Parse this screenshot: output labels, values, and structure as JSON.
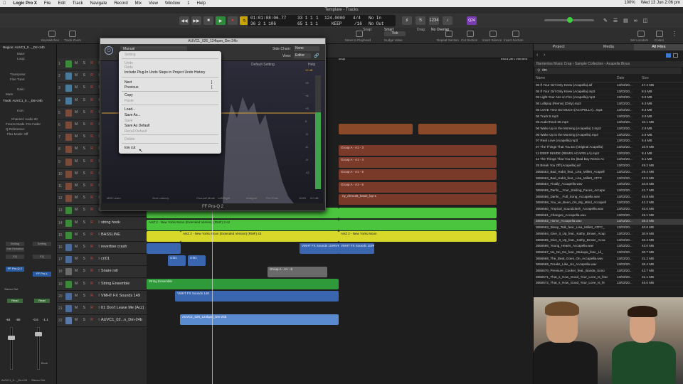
{
  "menubar": {
    "app": "Logic Pro X",
    "items": [
      "File",
      "Edit",
      "Track",
      "Navigate",
      "Record",
      "Mix",
      "View",
      "Window",
      "1",
      "Help"
    ],
    "clock": "Wed 13 Jun 2:06 pm",
    "battery": "100%"
  },
  "window_title": "Template - Tracks",
  "lcd": {
    "time": "01:01:08:06.77",
    "bars1": "33 1 1",
    "beats1": "1",
    "tempo": "124.0000",
    "sig": "4/4",
    "in": "No In",
    "time2": "36 2 1 106",
    "bars2": "65 1 1 1",
    "keep": "KEEP",
    "div": "/16",
    "out": "No Out"
  },
  "cpu": "Q24",
  "toolbar": {
    "labels": [
      "Keyswitches",
      "Track Zoom",
      "Move to Playhead",
      "Nudge Value",
      "Repeat Section",
      "Cut Section",
      "Insert Silence",
      "Insert Section",
      "Set Locators",
      "Colors",
      "Notes",
      "Lists",
      "Loops",
      "Browser"
    ],
    "snap_label": "Snap:",
    "snap_value": "Smart",
    "drag_label": "Drag:",
    "drag_value": "No Overlap",
    "tick": "Tick"
  },
  "inspector": {
    "region_label": "Region: AUVC1_0..._Dm-24b",
    "rows": [
      "Mute:",
      "Loop:",
      "Transpose:",
      "Fine Tune:",
      "Gain:",
      "More"
    ],
    "track_label": "Track: AUVC1_0..._Dm-24b",
    "track_rows": [
      "Icon:",
      "Channel: Audio 30",
      "Freeze Mode: Pre Fader",
      "Q-Reference:",
      "Flex Mode: Off"
    ],
    "strip_labels": [
      "Setting",
      "Gain Reduction",
      "EQ",
      "FF Pro-Q 2",
      "FF Pro-L",
      "Stereo Out",
      "Read",
      "Bnce",
      "Stereo Out"
    ],
    "meters": [
      "-64",
      "-88",
      "-0.6",
      "-1.1"
    ],
    "names": [
      "AUVC1_0..._Dm-24b",
      "Stereo Out"
    ]
  },
  "tracks": [
    {
      "n": "1",
      "name": ""
    },
    {
      "n": "2",
      "name": ""
    },
    {
      "n": "3",
      "name": ""
    },
    {
      "n": "4",
      "name": ""
    },
    {
      "n": "5",
      "name": ""
    },
    {
      "n": "6",
      "name": ""
    },
    {
      "n": "7",
      "name": ""
    },
    {
      "n": "8",
      "name": ""
    },
    {
      "n": "9",
      "name": ""
    },
    {
      "n": "10",
      "name": ""
    },
    {
      "n": "11",
      "name": ""
    },
    {
      "n": "12",
      "name": ""
    },
    {
      "n": "13",
      "name": "guitar loop"
    },
    {
      "n": "14",
      "name": "string hook"
    },
    {
      "n": "15",
      "name": "BASSLINE"
    },
    {
      "n": "16",
      "name": "reverbse crash"
    },
    {
      "n": "17",
      "name": "cri01"
    },
    {
      "n": "18",
      "name": "Snare roll"
    },
    {
      "n": "19",
      "name": "String Ensemble"
    },
    {
      "n": "20",
      "name": "VMHT FX Sounds 149"
    },
    {
      "n": "21",
      "name": "01 Don't Leave Me (Acc)"
    },
    {
      "n": "22",
      "name": "AUVC1_02...n_Dm-24b"
    }
  ],
  "regions": [
    "Group A - A1 - 3",
    "Group A - A1 - 4",
    "Group A - A1 - 5",
    "Group A - A1 - 6",
    "AHZ 2 - New Yorks Moon (Extended Version) (RMF) 3 A2",
    "AHZ 2 - New Yorks Moon (Extended Version) (RMF) 43",
    "AHZ 2 - New Yorks Moon",
    "VMHT FX Sounds 119RVE",
    "VMHT FX Sounds 119RVE",
    "cri01",
    "cri01",
    "Group A - A1 - 6",
    "String Ensemble",
    "VMHT FX Sounds 148",
    "AUVC1_026_124bpm_Dm-24b",
    "drop",
    "extra perc element",
    "ny_drm135_kasie_lop-1"
  ],
  "plugin": {
    "title": "AUVC1_026_124bpm_Dm-24b",
    "side_chain_label": "Side Chain:",
    "side_chain_value": "None",
    "view_label": "View:",
    "view_value": "Editor",
    "preset": "Manual",
    "default_setting": "Default Setting",
    "help": "Help",
    "footer": "FF Pro-Q 2",
    "bottom": [
      "MIDI Learn",
      "Zero Latency",
      "Channel Mode",
      "Left/Right",
      "Analyzer",
      "Pre+Post",
      "100%",
      "0.0 dB"
    ],
    "db_labels": [
      "12 dB",
      "+9",
      "+6",
      "+3",
      "0",
      "-3",
      "-6",
      "-9",
      "-12"
    ]
  },
  "context_menu": {
    "items": [
      {
        "label": "Setting",
        "disabled": true
      },
      {
        "label": "Undo",
        "disabled": true
      },
      {
        "label": "Redo",
        "disabled": true
      },
      {
        "label": "Include Plug-In Undo Steps in Project Undo History",
        "disabled": false
      },
      {
        "label": "Next",
        "disabled": false,
        "shortcut": "]"
      },
      {
        "label": "Previous",
        "disabled": false,
        "shortcut": "["
      },
      {
        "label": "Copy",
        "disabled": false
      },
      {
        "label": "Paste",
        "disabled": true
      },
      {
        "label": "Load...",
        "disabled": false
      },
      {
        "label": "Save As...",
        "disabled": false
      },
      {
        "label": "Save",
        "disabled": true
      },
      {
        "label": "Save As Default",
        "disabled": false
      },
      {
        "label": "Recall Default",
        "disabled": true
      },
      {
        "label": "Delete",
        "disabled": true
      },
      {
        "label": "low cut",
        "disabled": false
      }
    ]
  },
  "browser": {
    "tabs": [
      "Project",
      "Media",
      "All Files"
    ],
    "path": [
      "Barrientos Music Crap",
      "Sample Collection",
      "Acapella Biyus"
    ],
    "search": "dm",
    "cols": [
      "Name",
      "Date",
      "Size"
    ],
    "files": [
      [
        "05 If Your Girl Only Knew (Acapella).aif",
        "13/03/20...",
        "47.4 MB"
      ],
      [
        "05 If Your Girl Only Knew (Acapella).mp3",
        "13/03/20...",
        "8.5 MB"
      ],
      [
        "05 Light Your Ass on Fire (Acapella).mp3",
        "13/03/20...",
        "5.9 MB"
      ],
      [
        "05 Lollipop (Remix) (Dirty).mp3",
        "13/03/20...",
        "6.3 MB"
      ],
      [
        "05 LOVE YOU SO MUCH (ACAPELLA)...mp3",
        "13/03/20...",
        "8.3 MB"
      ],
      [
        "05 Track 5.mp3",
        "13/03/20...",
        "3.9 MB"
      ],
      [
        "06 AudioTrack 06.mp3",
        "13/03/20...",
        "10.1 MB"
      ],
      [
        "06 Wake Up in the Morning (Acapella) 2.mp3",
        "13/03/20...",
        "2.9 MB"
      ],
      [
        "06 Wake Up in the Morning (Acapella).mp3",
        "13/03/20...",
        "2.9 MB"
      ],
      [
        "07 Real Love (Acapella).mp3",
        "13/03/20...",
        "5.4 MB"
      ],
      [
        "07 The Things That You Do (Original Acapella)",
        "13/03/20...",
        "10.9 MB"
      ],
      [
        "11 DEEP INSIDE (REMIX ACAPELLA).mp3",
        "13/03/20...",
        "8.4 MB"
      ],
      [
        "11 The Things That You Do (Bad Boy Remix Ac",
        "13/03/20...",
        "8.1 MB"
      ],
      [
        "25 Break You Off (Acapella).aif",
        "13/03/20...",
        "49.2 MB"
      ],
      [
        "3656553_Bad_Habit_feat._Lisa_Millett_Acapell",
        "13/03/20...",
        "25.4 MB"
      ],
      [
        "3656553_Bad_Habit_feat._Lisa_Millett_ATFC",
        "13/03/20...",
        "42.5 MB"
      ],
      [
        "3656554_Finally_Accapella.wav",
        "13/03/20...",
        "34.8 MB"
      ],
      [
        "3656555_Darlin__Your_Smiling_Faces_Accape",
        "13/03/20...",
        "21.7 MB"
      ],
      [
        "3656556_Darlin__Full_Song_Accapella.wav",
        "13/03/20...",
        "48.8 MB"
      ],
      [
        "3656558_You_ve_Been_On_My_Mind_Accapell",
        "13/03/20...",
        "41.2 MB"
      ],
      [
        "3656560_Tropical_Soundclash_Accapella.wav",
        "13/03/20...",
        "40.0 MB"
      ],
      [
        "3656561_Changes_Accapella.wav",
        "13/03/20...",
        "45.1 MB"
      ],
      [
        "3656562_Home_Accapella.wav",
        "13/03/20...",
        "39.3 MB"
      ],
      [
        "3656563_Sleep_Talk_feat._Lisa_Millett_ATFC_",
        "13/03/20...",
        "40.6 MB"
      ],
      [
        "3656564_Give_It_Up_feat._Kathy_Brown_Acap",
        "13/03/20...",
        "30.9 MB"
      ],
      [
        "3656565_Give_It_Up_feat._Kathy_Brown_Acca",
        "13/03/20...",
        "32.4 MB"
      ],
      [
        "3656566_Young_Hearts_Accapella.wav",
        "13/03/20...",
        "43.0 MB"
      ],
      [
        "3656567_No_No_No_feat._Mukupa_feat._Lil_",
        "13/03/20...",
        "30.7 MB"
      ],
      [
        "3656568_The_Beat_Goes_On_Accapella.wav",
        "13/03/20...",
        "31.2 MB"
      ],
      [
        "3656569_Freaks_Like_Us_Accapella.wav",
        "13/03/20...",
        "35.4 MB"
      ],
      [
        "3656570_Pressure_Cooker_feat._Banda_Sono",
        "13/03/20...",
        "43.7 MB"
      ],
      [
        "3656571_That_s_How_Good_Your_Love_Is_feat",
        "13/03/20...",
        "31.1 MB"
      ],
      [
        "3656572_That_s_How_Good_Your_Love_Is_fe",
        "13/03/20...",
        "45.0 MB"
      ]
    ]
  }
}
